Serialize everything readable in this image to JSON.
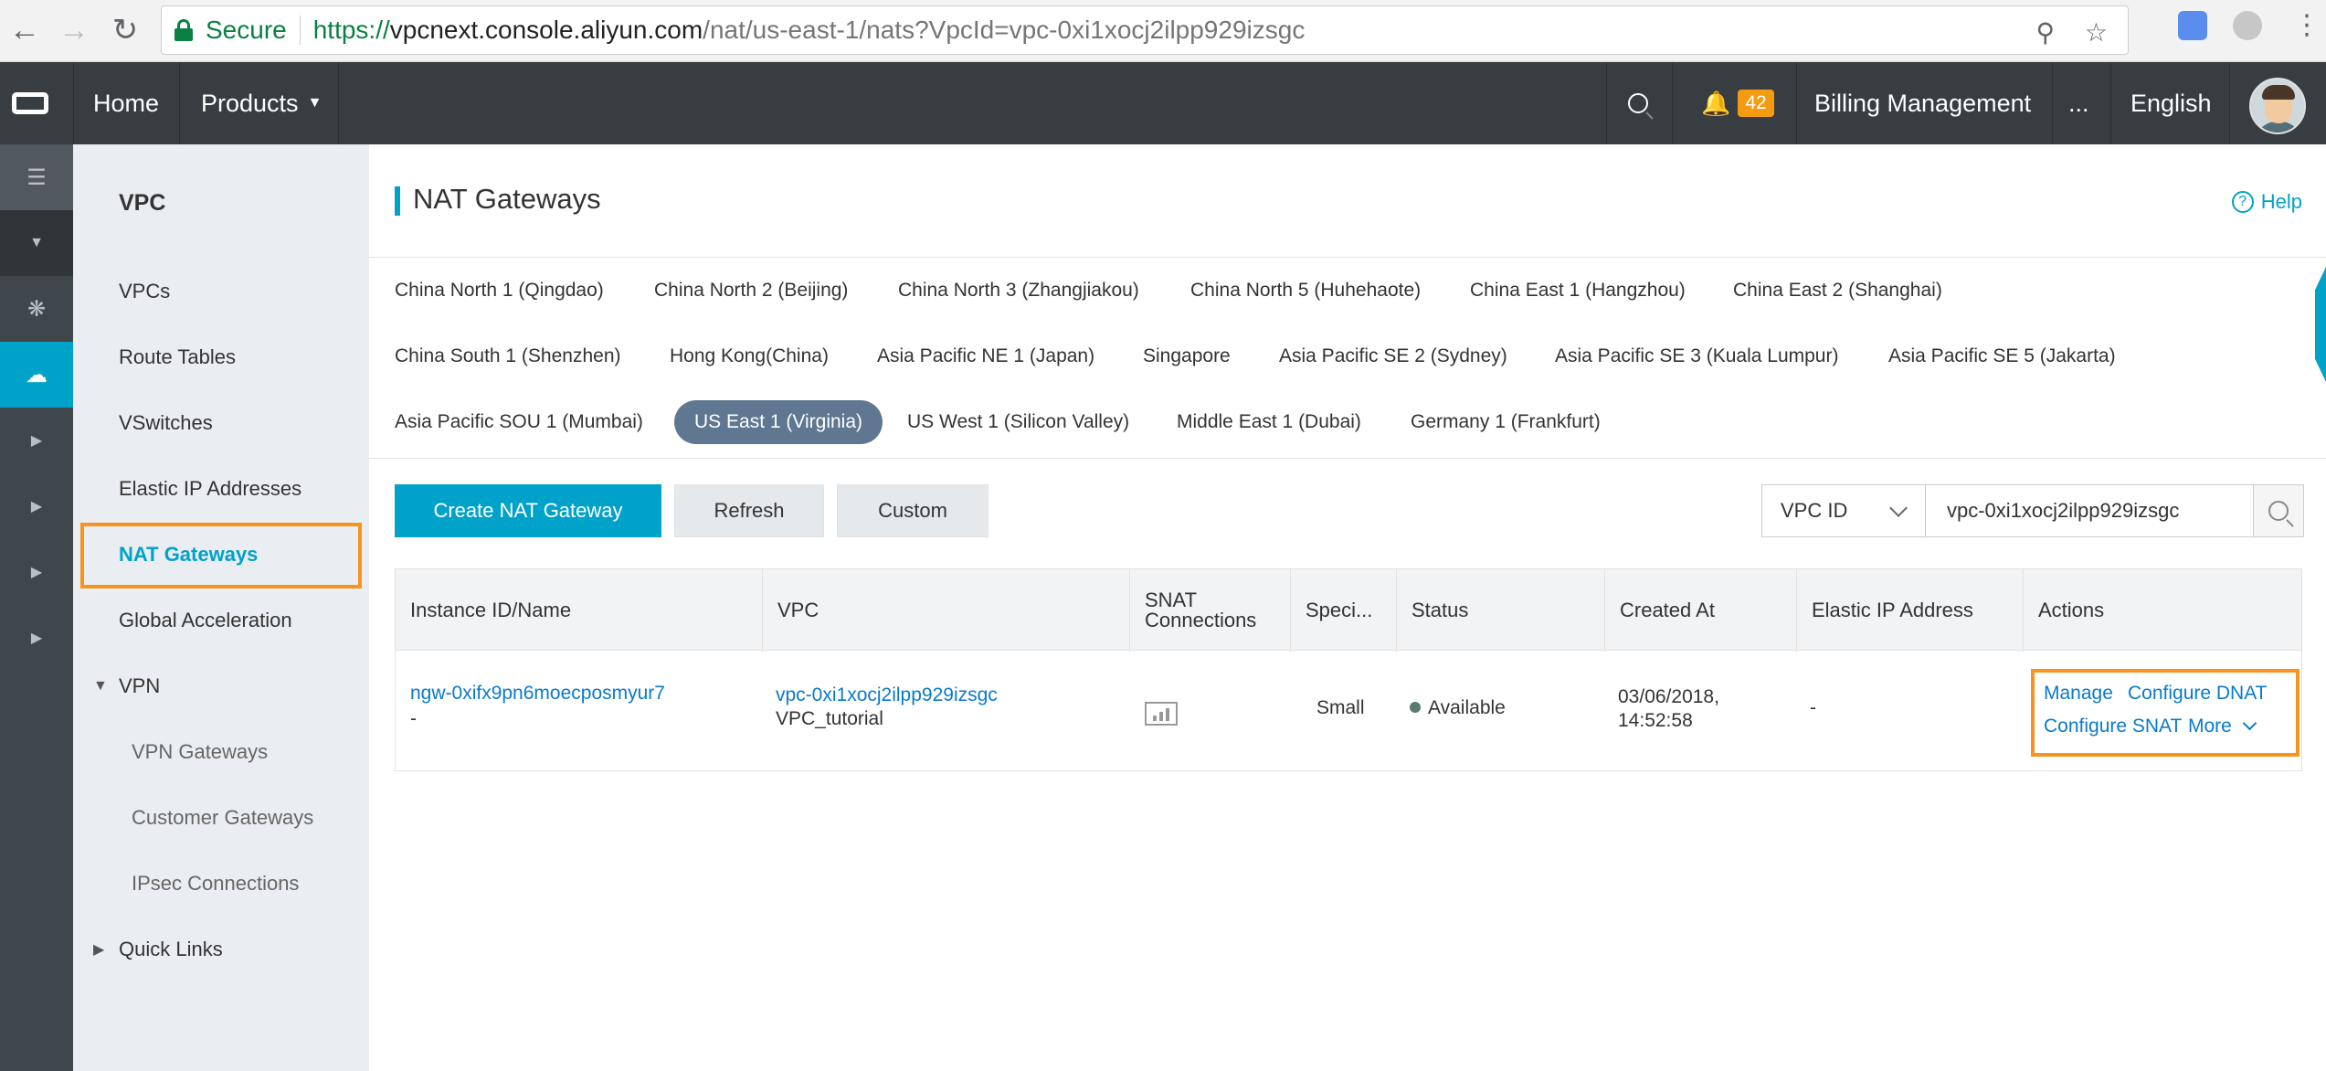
{
  "browser": {
    "secure_label": "Secure",
    "url_proto": "https://",
    "url_host": "vpcnext.console.aliyun.com",
    "url_path": "/nat/us-east-1/nats?VpcId=vpc-0xi1xocj2ilpp929izsgc"
  },
  "topnav": {
    "home": "Home",
    "products": "Products",
    "notification_count": "42",
    "billing": "Billing Management",
    "more": "...",
    "language": "English"
  },
  "sidebar": {
    "title": "VPC",
    "items": [
      "VPCs",
      "Route Tables",
      "VSwitches",
      "Elastic IP Addresses",
      "NAT Gateways",
      "Global Acceleration"
    ],
    "vpn_group": "VPN",
    "vpn_items": [
      "VPN Gateways",
      "Customer Gateways",
      "IPsec Connections"
    ],
    "quick_links": "Quick Links"
  },
  "page": {
    "title": "NAT Gateways",
    "help": "Help"
  },
  "regions": [
    "China North 1 (Qingdao)",
    "China North 2 (Beijing)",
    "China North 3 (Zhangjiakou)",
    "China North 5 (Huhehaote)",
    "China East 1 (Hangzhou)",
    "China East 2 (Shanghai)",
    "China South 1 (Shenzhen)",
    "Hong Kong(China)",
    "Asia Pacific NE 1 (Japan)",
    "Singapore",
    "Asia Pacific SE 2 (Sydney)",
    "Asia Pacific SE 3 (Kuala Lumpur)",
    "Asia Pacific SE 5 (Jakarta)",
    "Asia Pacific SOU 1 (Mumbai)",
    "US East 1 (Virginia)",
    "US West 1 (Silicon Valley)",
    "Middle East 1 (Dubai)",
    "Germany 1 (Frankfurt)"
  ],
  "selected_region": "US East 1 (Virginia)",
  "toolbar": {
    "create": "Create NAT Gateway",
    "refresh": "Refresh",
    "custom": "Custom",
    "search_field": "VPC ID",
    "search_value": "vpc-0xi1xocj2ilpp929izsgc"
  },
  "table": {
    "headers": [
      "Instance ID/Name",
      "VPC",
      "SNAT Connections",
      "Speci...",
      "Status",
      "Created At",
      "Elastic IP Address",
      "Actions"
    ],
    "row": {
      "instance_id": "ngw-0xifx9pn6moecposmyur7",
      "instance_name": "-",
      "vpc_id": "vpc-0xi1xocj2ilpp929izsgc",
      "vpc_name": "VPC_tutorial",
      "spec": "Small",
      "status": "Available",
      "created_date": "03/06/2018,",
      "created_time": "14:52:58",
      "eip": "-",
      "actions": {
        "manage": "Manage",
        "configure_dnat": "Configure DNAT",
        "configure_snat": "Configure SNAT",
        "more": "More"
      }
    }
  },
  "colors": {
    "accent": "#00a2ca",
    "highlight": "#f7931e",
    "topnav": "#373d41",
    "selected_region": "#5f7791"
  },
  "icons": [
    "back-icon",
    "forward-icon",
    "reload-icon",
    "lock-icon",
    "zoom-icon",
    "star-icon",
    "translate-icon",
    "search-icon",
    "bell-icon",
    "menu-icon",
    "help-icon",
    "chart-icon"
  ]
}
